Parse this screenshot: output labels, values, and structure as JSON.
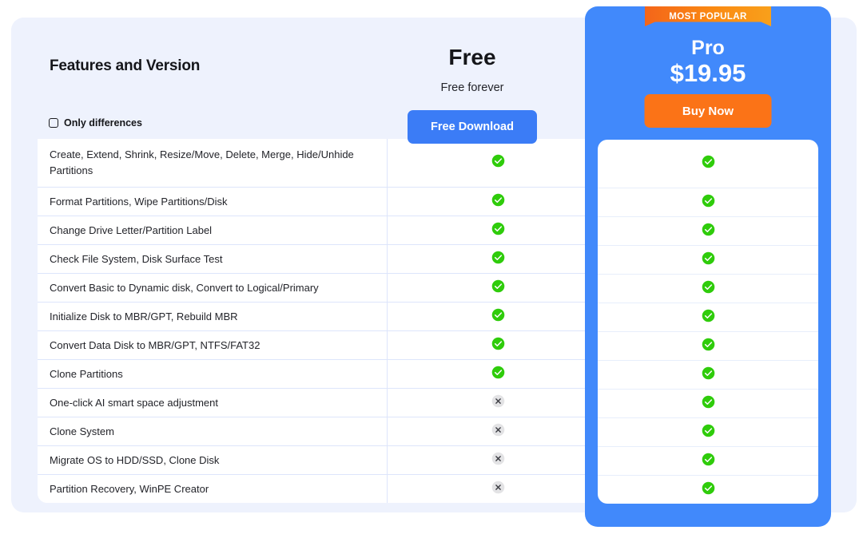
{
  "header": {
    "features_title": "Features and Version",
    "only_differences_label": "Only differences",
    "checkbox_state": "unchecked"
  },
  "plans": {
    "free": {
      "name": "Free",
      "subtitle": "Free forever",
      "cta_label": "Free Download",
      "cta_color": "#3b7cf6"
    },
    "pro": {
      "badge_label": "MOST POPULAR",
      "name": "Pro",
      "price": "$19.95",
      "cta_label": "Buy Now",
      "cta_color": "#fb7317",
      "panel_color": "#4189fb",
      "badge_color": "#f4651a"
    }
  },
  "icons": {
    "check_name": "check-circle-icon",
    "check_color": "#2fcc0b",
    "cross_name": "cross-circle-icon",
    "cross_color": "#3b3c42",
    "cross_bg": "#e3e3e5"
  },
  "features": [
    {
      "label": "Create, Extend, Shrink, Resize/Move, Delete, Merge, Hide/Unhide Partitions",
      "free": "check",
      "pro": "check",
      "tall": true
    },
    {
      "label": "Format Partitions, Wipe Partitions/Disk",
      "free": "check",
      "pro": "check",
      "tall": false
    },
    {
      "label": "Change Drive Letter/Partition Label",
      "free": "check",
      "pro": "check",
      "tall": false
    },
    {
      "label": "Check File System, Disk Surface Test",
      "free": "check",
      "pro": "check",
      "tall": false
    },
    {
      "label": "Convert Basic to Dynamic disk, Convert to Logical/Primary",
      "free": "check",
      "pro": "check",
      "tall": false
    },
    {
      "label": "Initialize Disk to MBR/GPT, Rebuild MBR",
      "free": "check",
      "pro": "check",
      "tall": false
    },
    {
      "label": "Convert Data Disk to MBR/GPT, NTFS/FAT32",
      "free": "check",
      "pro": "check",
      "tall": false
    },
    {
      "label": "Clone Partitions",
      "free": "check",
      "pro": "check",
      "tall": false
    },
    {
      "label": "One-click AI smart space adjustment",
      "free": "cross",
      "pro": "check",
      "tall": false
    },
    {
      "label": "Clone System",
      "free": "cross",
      "pro": "check",
      "tall": false
    },
    {
      "label": "Migrate OS to HDD/SSD, Clone Disk",
      "free": "cross",
      "pro": "check",
      "tall": false
    },
    {
      "label": "Partition Recovery, WinPE Creator",
      "free": "cross",
      "pro": "check",
      "tall": false
    }
  ]
}
